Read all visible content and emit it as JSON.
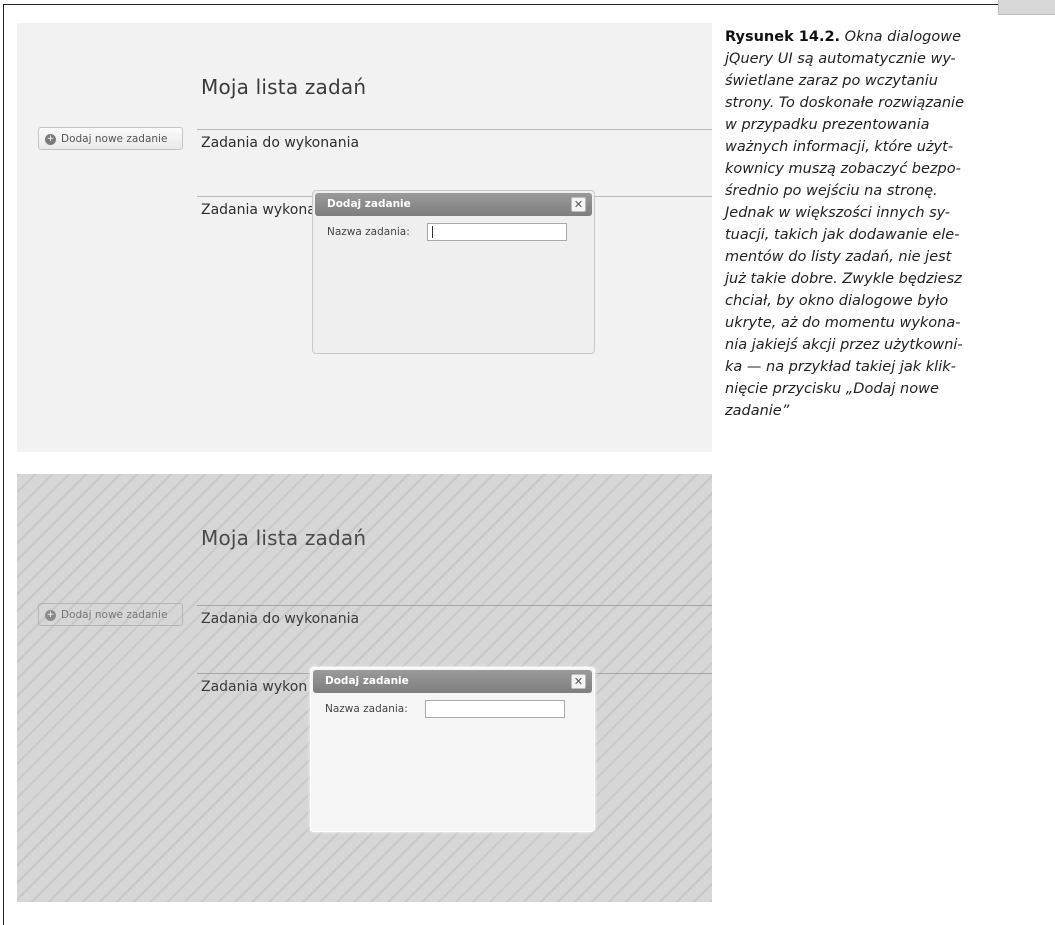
{
  "app": {
    "heading": "Moja lista zadań",
    "add_button_label": "Dodaj nowe zadanie",
    "section_todo": "Zadania do wykonania",
    "section_done": "Zadania wykonane",
    "section_done_partial": "Zadania wykon"
  },
  "dialog": {
    "title": "Dodaj zadanie",
    "close_glyph": "✕",
    "field_label": "Nazwa zadania:",
    "field_value": ""
  },
  "caption": {
    "label": "Rysunek 14.2.",
    "lines": [
      "Okna dialogowe",
      "jQuery UI są automatycznie wy-",
      "świetlane zaraz po wczytaniu",
      "strony. To doskonałe rozwiązanie",
      "w przypadku prezentowania",
      "ważnych informacji, które użyt-",
      "kownicy muszą zobaczyć bezpo-",
      "średnio po wejściu na stronę.",
      "Jednak w większości innych sy-",
      "tuacji, takich jak dodawanie ele-",
      "mentów do listy zadań, nie jest",
      "już takie dobre. Zwykle będziesz",
      "chciał, by okno dialogowe było",
      "ukryte, aż do momentu wykona-",
      "nia jakiejś akcji przez użytkowni-",
      "ka — na przykład takiej jak klik-",
      "nięcie przycisku „Dodaj nowe",
      "zadanie”"
    ]
  },
  "colors": {
    "titlebar": "#8a8a8a",
    "overlay_stripes": "#c8c8c8",
    "page_bg": "#f2f2f2"
  },
  "icons": {
    "add": "plus-circle-icon",
    "close": "close-icon"
  }
}
